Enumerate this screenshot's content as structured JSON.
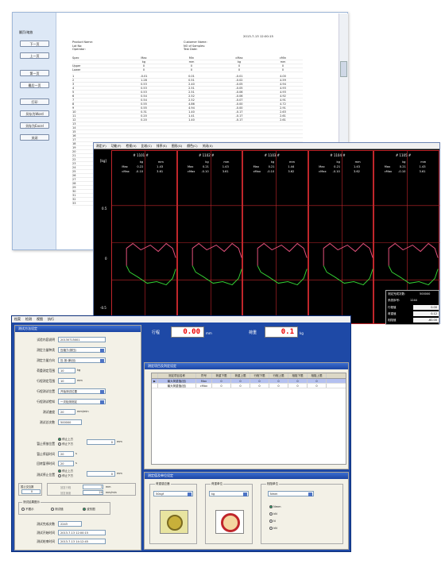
{
  "report": {
    "side_heading": "翻页/缩放",
    "buttons": [
      "下一页",
      "上一页",
      "第一页",
      "最后一页",
      "打印",
      "另存为Word",
      "另存为Excel",
      "关闭"
    ],
    "page_date": "2013-7-13 12:00:15",
    "meta_left": [
      "Product Name:",
      "Lot No:",
      "Operator:"
    ],
    "meta_right": [
      "Customer Name:",
      "NO of Samples:",
      "Test Date:"
    ],
    "columns": [
      "",
      "Max",
      "Min",
      "cMax",
      "cMin"
    ],
    "spec_rows": [
      [
        "Spec",
        "Max",
        "Min",
        "cMax",
        "cMin"
      ],
      [
        "",
        "kg",
        "mm",
        "kg",
        "mm"
      ],
      [
        "Upper",
        "0",
        "0",
        "0",
        "0"
      ],
      [
        "Lower",
        "0",
        "0",
        "0",
        "0"
      ]
    ],
    "data_rows": [
      [
        "1",
        "-0.01",
        "0.01",
        "-0.01",
        "4.00"
      ],
      [
        "2",
        "1.28",
        "0.51",
        "-0.02",
        "4.59"
      ],
      [
        "3",
        "0.53",
        "2.40",
        "-0.05",
        "4.94"
      ],
      [
        "4",
        "0.53",
        "2.51",
        "-0.05",
        "4.93"
      ],
      [
        "5",
        "0.53",
        "2.51",
        "-0.06",
        "4.93"
      ],
      [
        "6",
        "0.54",
        "2.52",
        "-0.06",
        "4.92"
      ],
      [
        "7",
        "0.54",
        "2.52",
        "-0.07",
        "4.91"
      ],
      [
        "8",
        "0.55",
        "4.86",
        "-0.00",
        "4.72"
      ],
      [
        "9",
        "0.55",
        "4.94",
        "-0.00",
        "2.91"
      ],
      [
        "10",
        "0.31",
        "1.40",
        "-0.17",
        "2.63"
      ],
      [
        "11",
        "0.20",
        "1.41",
        "-0.17",
        "2.61"
      ],
      [
        "12",
        "0.20",
        "1.40",
        "-0.17",
        "2.61"
      ]
    ],
    "more_row_numbers": [
      "13",
      "14",
      "15",
      "16",
      "17",
      "18",
      "19",
      "20",
      "21",
      "22",
      "23",
      "24",
      "25",
      "26",
      "27",
      "28",
      "29",
      "30",
      "31",
      "32",
      "33"
    ]
  },
  "scope": {
    "menu": [
      "测定(F)",
      "功能(F)",
      "检视(V)",
      "比较(C)",
      "排序(S)",
      "图形(G)",
      "颜色(C)",
      "关闭(X)"
    ],
    "y_unit": "[kg]",
    "y_ticks": [
      "0.5",
      "0",
      "-0.5"
    ],
    "channels": [
      {
        "title": "# 1101 #",
        "units": [
          "kg",
          "mm"
        ],
        "max": [
          "0.22",
          "1.43"
        ],
        "cmax": [
          "-0.10",
          "3.61"
        ]
      },
      {
        "title": "# 1102 #",
        "units": [
          "kg",
          "mm"
        ],
        "max": [
          "0.21",
          "1.43"
        ],
        "cmax": [
          "-0.10",
          "3.61"
        ]
      },
      {
        "title": "# 1103 #",
        "units": [
          "kg",
          "mm"
        ],
        "max": [
          "0.21",
          "1.44"
        ],
        "cmax": [
          "-0.10",
          "3.62"
        ]
      },
      {
        "title": "# 1104 #",
        "units": [
          "kg",
          "mm"
        ],
        "max": [
          "0.21",
          "1.43"
        ],
        "cmax": [
          "-0.10",
          "3.62"
        ]
      },
      {
        "title": "# 1105 #",
        "units": [
          "kg",
          "mm"
        ],
        "max": [
          "0.21",
          "1.43"
        ],
        "cmax": [
          "-0.10",
          "3.61"
        ]
      }
    ],
    "row_labels": [
      "Max",
      "cMax"
    ],
    "popup": {
      "count_label": "测定完成次数:",
      "count_value": "500000",
      "sys_label": "系统序号:",
      "sys_value": "1244",
      "rows": [
        {
          "label": "行程值",
          "value": "0.00"
        },
        {
          "label": "荷重值",
          "value": "0.12"
        },
        {
          "label": "相阻值",
          "value": "-60.00"
        }
      ]
    },
    "bottom_unit": "[mm/0.1]"
  },
  "settings": {
    "menu": [
      "档案",
      "检测",
      "视图",
      "执行"
    ],
    "left_title": "测试方法设定",
    "form": [
      {
        "label": "试验内容说明",
        "value": "20130715001"
      },
      {
        "label": "测定力量种类",
        "value": "压缩力(按压)"
      },
      {
        "label": "测定力量方向",
        "value": "压-按-弹(回)"
      },
      {
        "label": "荷重测定范围",
        "value": "10",
        "unit": "kg"
      },
      {
        "label": "行程测定范围",
        "value": "10",
        "unit": "mm"
      },
      {
        "label": "行程测试位置",
        "value": "开始测试位置"
      },
      {
        "label": "行程测试检知",
        "value": "一次检测测定"
      },
      {
        "label": "测试速度",
        "value": "20",
        "unit": "mm/min"
      },
      {
        "label": "测试总次数",
        "value": "500000"
      }
    ],
    "radio_stop": [
      "停止上方",
      "停止下方"
    ],
    "stop_label": "暂止停放位置",
    "stop_value": "0",
    "stop_unit": "mm",
    "time_fields": [
      {
        "label": "暂止停延时间",
        "value": "20",
        "unit": "s"
      },
      {
        "label": "回转暂停时间",
        "value": "20",
        "unit": "s"
      }
    ],
    "stop2_label": "测试停止位置",
    "stop2_value": "0",
    "stop2_unit": "mm",
    "sub_label": "暂止交互数",
    "sub_value": "0",
    "sub_fields": [
      {
        "label": "回复行程",
        "value": "1",
        "unit": "mm"
      },
      {
        "label": "回复速度",
        "value": "20",
        "unit": "mm/min"
      }
    ],
    "graph_group": "测试结果图示",
    "graph_options": [
      "不图示",
      "测试值",
      "波形图"
    ],
    "info": [
      {
        "label": "测试完成次数",
        "value": "2243"
      },
      {
        "label": "测试开始时间",
        "value": "2013-7-13 12:00:15"
      },
      {
        "label": "测试结束时间",
        "value": "2013-7-13 14:12:45"
      }
    ],
    "stroke_label": "行程",
    "stroke_value": "0.00",
    "stroke_unit": "mm",
    "load_label": "荷重",
    "load_value": "0.1",
    "load_unit": "kg",
    "table_title": "测定项目及判定设定",
    "table_headers": [
      "",
      "测定项目名称",
      "符号",
      "荷重下限",
      "荷重上限",
      "行程下限",
      "行程上限",
      "相阻下限",
      "相阻上限"
    ],
    "table_rows": [
      [
        "▶",
        "最大荷重值(回)",
        "Max",
        "0",
        "0",
        "0",
        "0",
        "0",
        "0"
      ],
      [
        "",
        "最大荷重值(回)",
        "cMax",
        "0",
        "0",
        "0",
        "0",
        "0",
        "0"
      ]
    ],
    "unit_title": "测定值及单位设定",
    "load_sensor_label": "荷重感应器",
    "load_sensor_value": "50kgf",
    "load_unit_group": "荷重单位",
    "load_unit_value": "kg",
    "phase_unit_group": "相阻单位",
    "phase_unit_value": "Nmm",
    "phase_options": [
      "Nmm",
      "kN",
      "N",
      "kN"
    ]
  },
  "colors": {
    "accent": "#1e49a6",
    "scope_bg": "#000000",
    "grid": "#c0262b",
    "wave_upper": "#e0507a",
    "wave_lower": "#33cc33"
  }
}
